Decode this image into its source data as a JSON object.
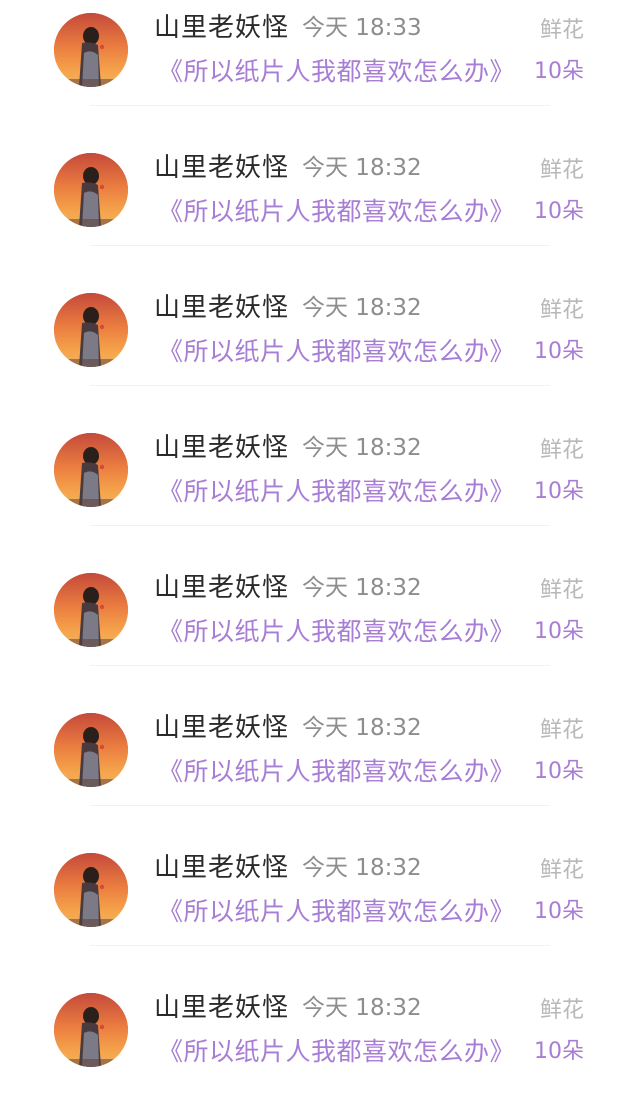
{
  "colors": {
    "name": "#2a2a2a",
    "time": "#8d8d8d",
    "gift_label": "#b8b8b8",
    "accent_purple": "#a77dd5"
  },
  "items": [
    {
      "avatar_icon": "girl-sunset-avatar-icon",
      "name": "山里老妖怪",
      "time": "今天 18:33",
      "gift_label": "鲜花",
      "work_title": "《所以纸片人我都喜欢怎么办》",
      "gift_count": "10朵"
    },
    {
      "avatar_icon": "girl-sunset-avatar-icon",
      "name": "山里老妖怪",
      "time": "今天 18:32",
      "gift_label": "鲜花",
      "work_title": "《所以纸片人我都喜欢怎么办》",
      "gift_count": "10朵"
    },
    {
      "avatar_icon": "girl-sunset-avatar-icon",
      "name": "山里老妖怪",
      "time": "今天 18:32",
      "gift_label": "鲜花",
      "work_title": "《所以纸片人我都喜欢怎么办》",
      "gift_count": "10朵"
    },
    {
      "avatar_icon": "girl-sunset-avatar-icon",
      "name": "山里老妖怪",
      "time": "今天 18:32",
      "gift_label": "鲜花",
      "work_title": "《所以纸片人我都喜欢怎么办》",
      "gift_count": "10朵"
    },
    {
      "avatar_icon": "girl-sunset-avatar-icon",
      "name": "山里老妖怪",
      "time": "今天 18:32",
      "gift_label": "鲜花",
      "work_title": "《所以纸片人我都喜欢怎么办》",
      "gift_count": "10朵"
    },
    {
      "avatar_icon": "girl-sunset-avatar-icon",
      "name": "山里老妖怪",
      "time": "今天 18:32",
      "gift_label": "鲜花",
      "work_title": "《所以纸片人我都喜欢怎么办》",
      "gift_count": "10朵"
    },
    {
      "avatar_icon": "girl-sunset-avatar-icon",
      "name": "山里老妖怪",
      "time": "今天 18:32",
      "gift_label": "鲜花",
      "work_title": "《所以纸片人我都喜欢怎么办》",
      "gift_count": "10朵"
    },
    {
      "avatar_icon": "girl-sunset-avatar-icon",
      "name": "山里老妖怪",
      "time": "今天 18:32",
      "gift_label": "鲜花",
      "work_title": "《所以纸片人我都喜欢怎么办》",
      "gift_count": "10朵"
    }
  ]
}
